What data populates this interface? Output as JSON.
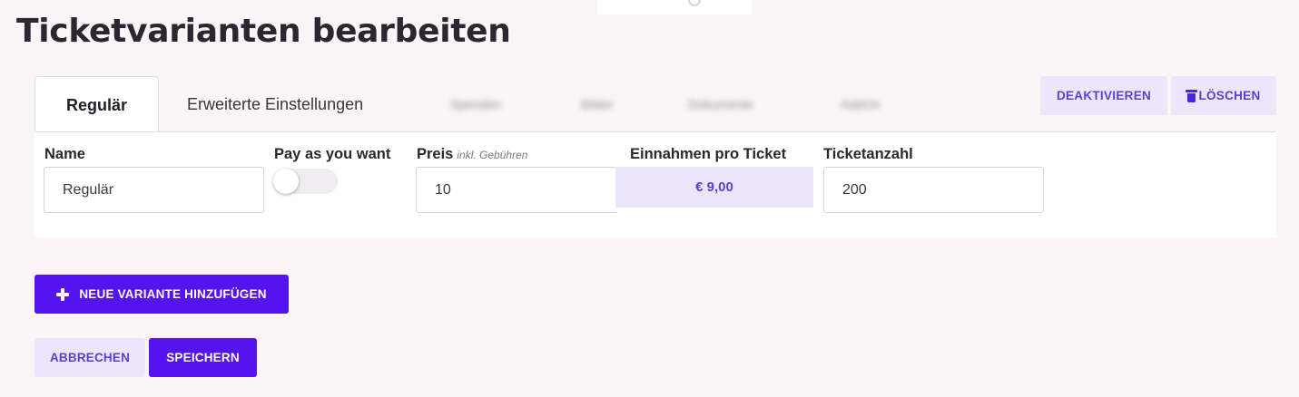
{
  "page": {
    "title": "Ticketvarianten bearbeiten"
  },
  "tabs": [
    {
      "label": "Regulär",
      "active": true
    },
    {
      "label": "Erweiterte Einstellungen",
      "active": false
    },
    {
      "label": "Spenden",
      "active": false,
      "blurred": true
    },
    {
      "label": "Bilder",
      "active": false,
      "blurred": true
    },
    {
      "label": "Dokumente",
      "active": false,
      "blurred": true
    },
    {
      "label": "AddOn",
      "active": false,
      "blurred": true
    }
  ],
  "actions": {
    "deactivate_label": "DEAKTIVIEREN",
    "delete_label": "LÖSCHEN",
    "delete_icon": "trash-icon"
  },
  "form": {
    "name": {
      "label": "Name",
      "value": "Regulär"
    },
    "pay_as_you_want": {
      "label": "Pay as you want",
      "enabled": false
    },
    "price": {
      "label": "Preis",
      "hint": "inkl. Gebühren",
      "value": "10"
    },
    "revenue_per_ticket": {
      "label": "Einnahmen pro Ticket",
      "value": "€  9,00"
    },
    "ticket_count": {
      "label": "Ticketanzahl",
      "value": "200"
    }
  },
  "buttons": {
    "add_variant_label": "NEUE VARIANTE HINZUFÜGEN",
    "add_variant_icon": "plus-icon",
    "cancel_label": "ABBRECHEN",
    "save_label": "SPEICHERN"
  },
  "colors": {
    "primary": "#5414f0",
    "accent_light": "#ebe6fa",
    "accent_text": "#5b3fd0",
    "background": "#fbf5f7"
  }
}
